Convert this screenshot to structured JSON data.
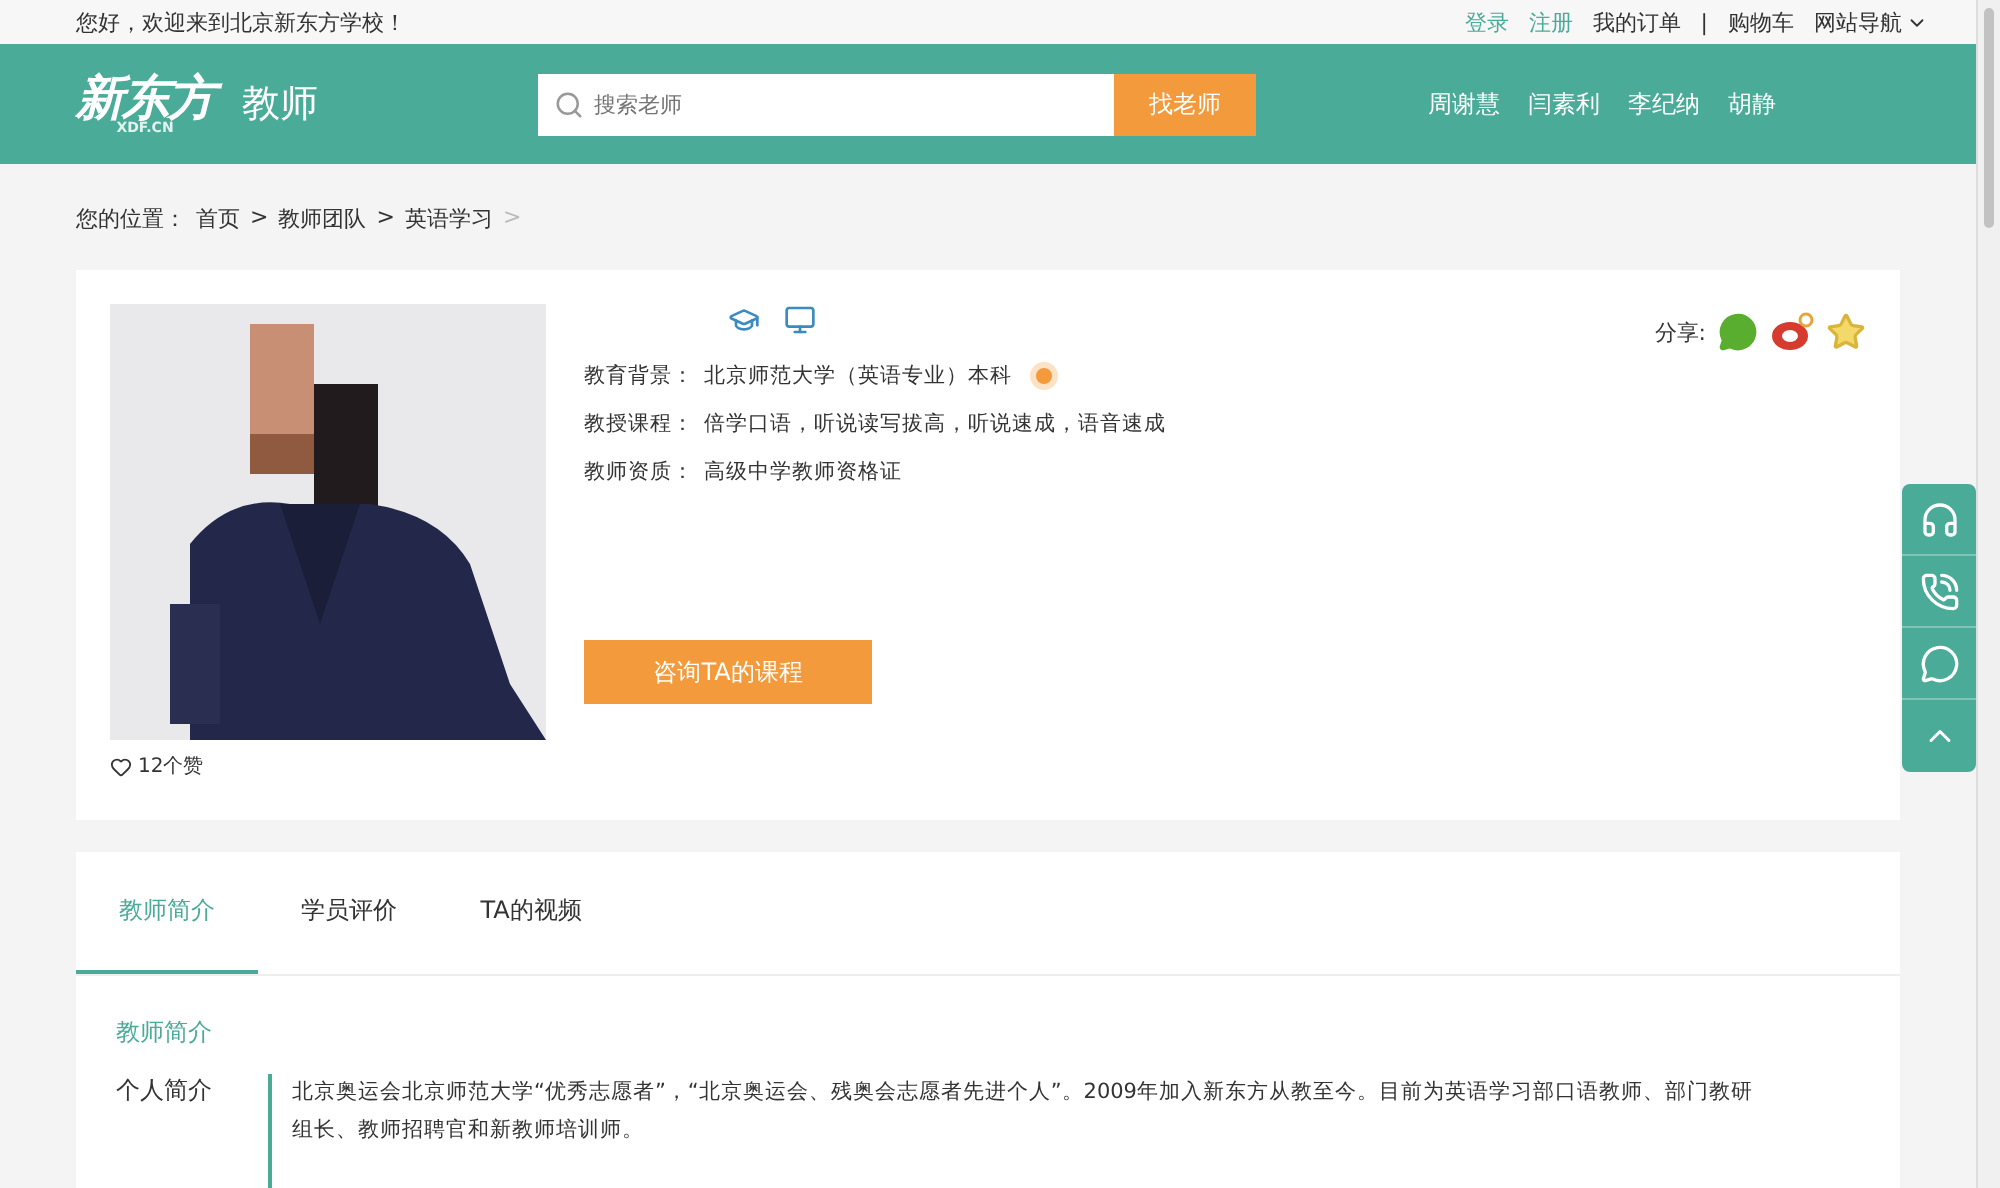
{
  "top_bar": {
    "welcome": "您好，欢迎来到北京新东方学校！",
    "links": [
      {
        "label": "登录",
        "kind": "accent"
      },
      {
        "label": "注册",
        "kind": "accent"
      },
      {
        "label": "我的订单",
        "kind": "plain"
      },
      {
        "label": "|",
        "kind": "separator"
      },
      {
        "label": "购物车",
        "kind": "plain"
      },
      {
        "label": "网站导航",
        "kind": "dropdown"
      }
    ]
  },
  "header": {
    "logo": "新东方",
    "logo_sub": "XDF.CN",
    "section": "教师",
    "search": {
      "placeholder": "搜索老师"
    },
    "search_button": "找老师",
    "nav": [
      "周谢慧",
      "闫素利",
      "李纪纳",
      "胡静"
    ]
  },
  "breadcrumb": {
    "label": "您的位置：",
    "items": [
      "首页",
      "教师团队",
      "英语学习"
    ],
    "separator": ">"
  },
  "profile": {
    "likes": "12个赞",
    "fields": [
      {
        "label": "教育背景：",
        "value": "北京师范大学（英语专业）本科",
        "badge": true
      },
      {
        "label": "教授课程：",
        "value": "倍学口语，听说读写拔高，听说速成，语音速成",
        "badge": false
      },
      {
        "label": "教师资质：",
        "value": "高级中学教师资格证",
        "badge": false
      }
    ],
    "consult_button": "咨询TA的课程",
    "share_label": "分享:"
  },
  "tabs": [
    {
      "label": "教师简介",
      "selected": true
    },
    {
      "label": "学员评价",
      "selected": false
    },
    {
      "label": "TA的视频",
      "selected": false
    }
  ],
  "intro": {
    "heading": "教师简介",
    "rows": [
      {
        "label": "个人简介",
        "text": "北京奥运会北京师范大学“优秀志愿者”，“北京奥运会、残奥会志愿者先进个人”。2009年加入新东方从教至今。目前为英语学习部口语教师、部门教研组长、教师招聘官和新教师培训师。"
      }
    ]
  }
}
